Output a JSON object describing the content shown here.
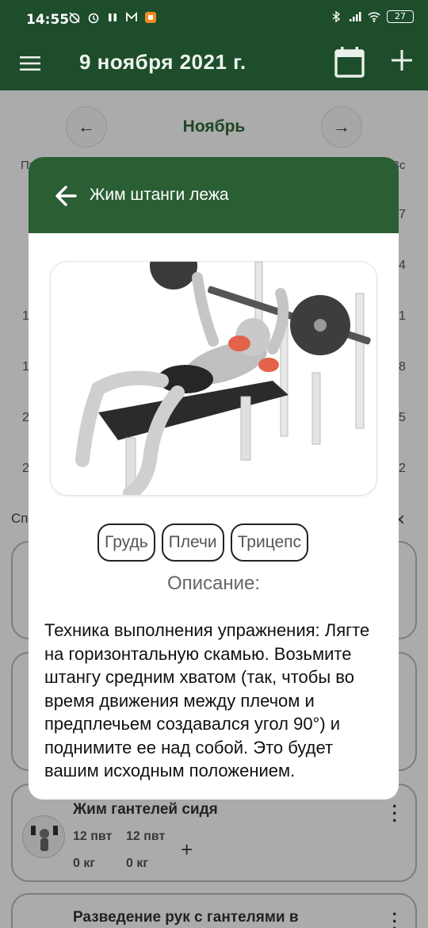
{
  "status_bar": {
    "time": "14:55",
    "battery": "27"
  },
  "app_bar": {
    "title": "9 ноября 2021 г."
  },
  "calendar": {
    "month": "Ноябрь",
    "prev_label": "←",
    "next_label": "→",
    "weekday_first": "Пн",
    "weekday_last": "Вс",
    "left_numbers": [
      "1",
      "1",
      "2",
      "2"
    ],
    "right_numbers": [
      "7",
      "4",
      "1",
      "8",
      "5",
      "2"
    ]
  },
  "list": {
    "label": "Сп",
    "close": "×",
    "cards": [
      {
        "title": "Жим гантелей сидя",
        "reps": [
          "12 пвт",
          "12 пвт"
        ],
        "weights": [
          "0 кг",
          "0 кг"
        ],
        "add": "+",
        "thumb": "dumbbell-press-thumbnail"
      },
      {
        "title": "Разведение рук с гантелями в",
        "thumb": "dumbbell-fly-thumbnail"
      }
    ]
  },
  "dialog": {
    "title": "Жим штанги лежа",
    "image": "bench-press-illustration",
    "tags": [
      "Грудь",
      "Плечи",
      "Трицепс"
    ],
    "description_label": "Описание:",
    "description": "Техника выполнения упражнения: Лягте на горизонтальную скамью. Возьмите штангу средним хватом (так, чтобы во время движения между плечом и предплечьем создавался угол 90°) и поднимите ее над собой. Это будет вашим исходным положением."
  },
  "icons": {
    "menu": "menu-icon",
    "calendar": "calendar-icon",
    "add": "plus-icon",
    "back": "arrow-back-icon",
    "more": "more-vert-icon"
  },
  "colors": {
    "app_bar": "#1e4d2b",
    "dialog_header": "#2a5e33",
    "month_text": "#2d6a35"
  }
}
